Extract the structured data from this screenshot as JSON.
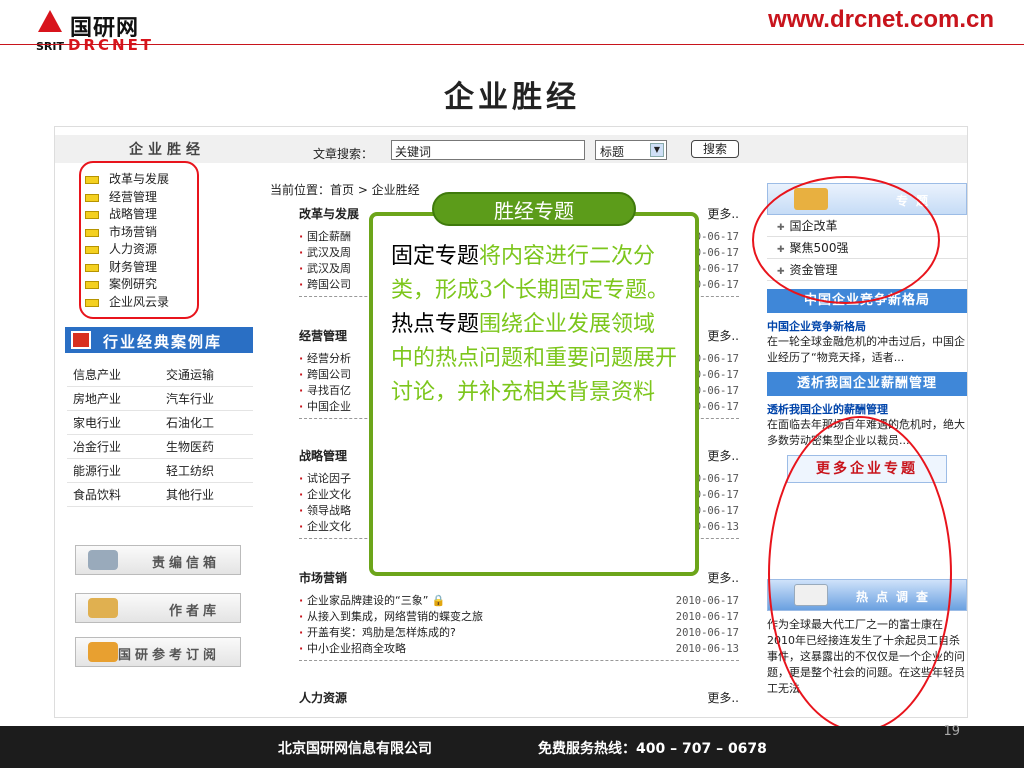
{
  "brand": {
    "logo_cn": "国研网",
    "logo_srit": "SRIT",
    "logo_en": "DRCNET",
    "url": "www.drcnet.com.cn"
  },
  "slide": {
    "title": "企业胜经",
    "page_number": "19"
  },
  "footer": {
    "company": "北京国研网信息有限公司",
    "hotline": "免费服务热线：400 – 707 – 0678"
  },
  "screenshot": {
    "left_header": "企业胜经",
    "search": {
      "label": "文章搜索：",
      "value": "关键词",
      "select_value": "标题",
      "button": "搜索"
    },
    "categories": [
      "改革与发展",
      "经营管理",
      "战略管理",
      "市场营销",
      "人力资源",
      "财务管理",
      "案例研究",
      "企业风云录"
    ],
    "case_library": {
      "title": "行业经典案例库",
      "rows": [
        [
          "信息产业",
          "交通运输"
        ],
        [
          "房地产业",
          "汽车行业"
        ],
        [
          "家电行业",
          "石油化工"
        ],
        [
          "冶金行业",
          "生物医药"
        ],
        [
          "能源行业",
          "轻工纺织"
        ],
        [
          "食品饮料",
          "其他行业"
        ]
      ]
    },
    "side_buttons": [
      "责编信箱",
      "作者库",
      "国研参考订阅"
    ],
    "breadcrumb": "当前位置：首页 > 企业胜经",
    "more_label": "更多..",
    "sections": [
      {
        "title": "改革与发展",
        "items": [
          {
            "text": "国企薪酬",
            "date": "2010-06-17"
          },
          {
            "text": "武汉及周",
            "date": "2010-06-17"
          },
          {
            "text": "武汉及周",
            "date": "2010-06-17"
          },
          {
            "text": "跨国公司",
            "date": "2010-06-17"
          }
        ]
      },
      {
        "title": "经营管理",
        "items": [
          {
            "text": "经营分析",
            "date": "2010-06-17"
          },
          {
            "text": "跨国公司",
            "date": "2010-06-17"
          },
          {
            "text": "寻找百亿",
            "date": "2010-06-17"
          },
          {
            "text": "中国企业",
            "date": "2010-06-17"
          }
        ]
      },
      {
        "title": "战略管理",
        "items": [
          {
            "text": "试论因子",
            "date": "2010-06-17"
          },
          {
            "text": "企业文化",
            "date": "2010-06-17"
          },
          {
            "text": "领导战略",
            "date": "2010-06-17"
          },
          {
            "text": "企业文化",
            "date": "2010-06-13"
          }
        ]
      },
      {
        "title": "市场营销",
        "items": [
          {
            "text": "企业家品牌建设的“三象” ",
            "date": "2010-06-17"
          },
          {
            "text": "从接入到集成，网络营销的蝶变之旅",
            "date": "2010-06-17"
          },
          {
            "text": "开盖有奖：鸡肋是怎样炼成的?",
            "date": "2010-06-17"
          },
          {
            "text": "中小企业招商全攻略",
            "date": "2010-06-13"
          }
        ]
      },
      {
        "title": "人力资源",
        "items": []
      }
    ],
    "right": {
      "topics_header": "专题",
      "topics": [
        "国企改革",
        "聚焦500强",
        "资金管理"
      ],
      "banner1": "中国企业竞争新格局",
      "news1_title": "中国企业竞争新格局",
      "news1_text": "在一轮全球金融危机的冲击过后，中国企业经历了“物竞天择，适者...",
      "banner2": "透析我国企业薪酬管理",
      "news2_title": "透析我国企业的薪酬管理",
      "news2_text": "在面临去年那场百年难遇的危机时，绝大多数劳动密集型企业以裁员...",
      "more_topics": "更多企业专题",
      "survey_header": "热点调查",
      "survey_text": "作为全球最大代工厂之一的富士康在2010年已经接连发生了十余起员工自杀事件，这暴露出的不仅仅是一个企业的问题，更是整个社会的问题。在这些年轻员工无法"
    }
  },
  "overlay": {
    "tab": "胜经专题",
    "fixed_label": "固定专题",
    "fixed_text": "将内容进行二次分类，形成3个长期固定专题。",
    "hot_label": "热点专题",
    "hot_text": "围绕企业发展领域中的热点问题和重要问题展开讨论，并补充相关背景资料"
  },
  "colors": {
    "brand_red": "#c8141c",
    "callout_green": "#6ca51a",
    "link_blue": "#3f87d8"
  }
}
